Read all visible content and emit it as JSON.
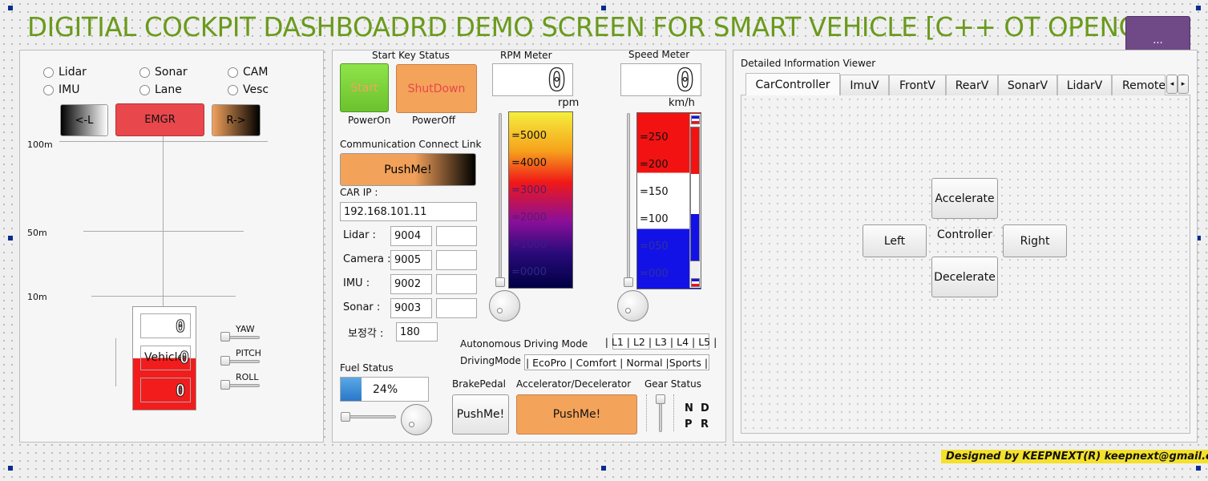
{
  "app": {
    "title": "DIGITIAL COCKPIT DASHBOADRD DEMO SCREEN FOR SMART VEHICLE [C++ OT OPENCV]",
    "corner_button": "...",
    "footer": "Designed by KEEPNEXT(R) keepnext@gmail.com"
  },
  "sensors": {
    "radios": [
      "Lidar",
      "Sonar",
      "CAM",
      "IMU",
      "Lane",
      "Vesc"
    ],
    "left_button": "<-L",
    "emergency_button": "EMGR",
    "right_button": "R->",
    "distance_labels": [
      "100m",
      "50m",
      "10m"
    ],
    "vehicle_label": "Vehicle",
    "lcd_values": [
      "0",
      "0",
      "0"
    ],
    "attitude_labels": [
      "YAW",
      "PITCH",
      "ROLL"
    ]
  },
  "start_key": {
    "heading": "Start Key Status",
    "start_label": "Start",
    "shutdown_label": "ShutDown",
    "power_on": "PowerOn",
    "power_off": "PowerOff"
  },
  "comm": {
    "heading": "Communication Connect Link",
    "push_label": "PushMe!",
    "car_ip_label": "CAR IP :",
    "car_ip_value": "192.168.101.11",
    "ports": [
      {
        "label": "Lidar :",
        "value": "9004"
      },
      {
        "label": "Camera :",
        "value": "9005"
      },
      {
        "label": "IMU :",
        "value": "9002"
      },
      {
        "label": "Sonar :",
        "value": "9003"
      }
    ],
    "correction_label": "보정각 :",
    "correction_value": "180"
  },
  "rpm": {
    "heading": "RPM Meter",
    "value": "0",
    "unit": "rpm",
    "scale": [
      "=5000",
      "=4000",
      "=3000",
      "=2000",
      "=1000",
      "=0000"
    ]
  },
  "speed": {
    "heading": "Speed Meter",
    "value": "0",
    "unit": "km/h",
    "scale": [
      "=250",
      "=200",
      "=150",
      "=100",
      "=050",
      "=000"
    ]
  },
  "fuel": {
    "heading": "Fuel Status",
    "percent_text": "24%",
    "level": 0.24
  },
  "driving": {
    "autonomous_label": "Autonomous Driving Mode",
    "autonomous_levels": "| L1 | L2 | L3 | L4 | L5 |",
    "mode_label": "DrivingMode",
    "modes": "| EcoPro | Comfort | Normal |Sports |"
  },
  "pedals": {
    "brake_heading": "BrakePedal",
    "brake_label": "PushMe!",
    "accel_heading": "Accelerator/Decelerator",
    "accel_label": "PushMe!",
    "gear_heading": "Gear Status",
    "gears": [
      "N",
      "D",
      "P",
      "R"
    ]
  },
  "viewer": {
    "heading": "Detailed Information Viewer",
    "tabs": [
      "CarController",
      "ImuV",
      "FrontV",
      "RearV",
      "SonarV",
      "LidarV",
      "Remote"
    ],
    "accelerate": "Accelerate",
    "decelerate": "Decelerate",
    "left": "Left",
    "right": "Right",
    "controller": "Controller"
  },
  "colors": {
    "title_green": "#6a9a1c",
    "emgr_red": "#e8474c",
    "start_green": "#7fd23c",
    "shutdown_orange": "#f4a35a",
    "corner_purple": "#6f4a86",
    "footer_yellow": "#f4e12a"
  }
}
